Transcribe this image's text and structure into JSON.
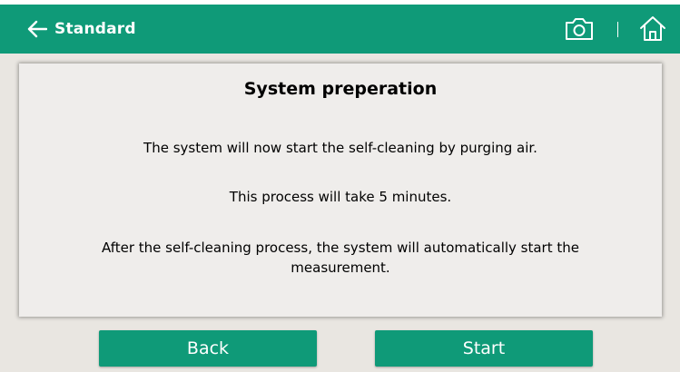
{
  "header": {
    "back_label": "Standard",
    "icons": [
      "arrow-left-icon",
      "camera-icon",
      "home-icon"
    ]
  },
  "panel": {
    "title": "System preperation",
    "line1": "The system will now start the self-cleaning by purging air.",
    "line2": "This process will take 5 minutes.",
    "line3": "After the self-cleaning process, the system will automatically start the measurement."
  },
  "buttons": {
    "back_label": "Back",
    "start_label": "Start"
  },
  "colors": {
    "accent": "#0f9a78",
    "background": "#e9e6e1",
    "panel": "#efedeb"
  }
}
